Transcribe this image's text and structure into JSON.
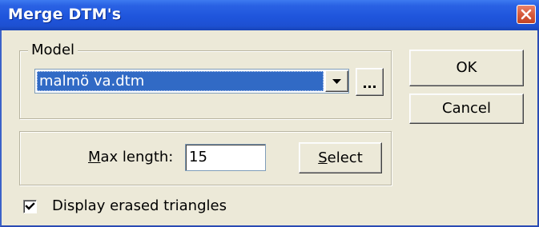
{
  "window": {
    "title": "Merge DTM's",
    "close_icon": "close-x-icon",
    "titlebar_color": "#1f55dc",
    "close_color": "#d65a3c"
  },
  "model_group": {
    "legend": "Model",
    "combo_value": "malmö va.dtm",
    "dropdown_icon": "chevron-down-icon",
    "browse_label": "..."
  },
  "buttons": {
    "ok": "OK",
    "cancel": "Cancel"
  },
  "max_group": {
    "label_mnemonic": "M",
    "label_rest": "ax length:",
    "value": "15",
    "select_mnemonic": "S",
    "select_rest": "elect"
  },
  "options": {
    "display_erased_checked": true,
    "display_erased_label": "Display erased triangles"
  }
}
